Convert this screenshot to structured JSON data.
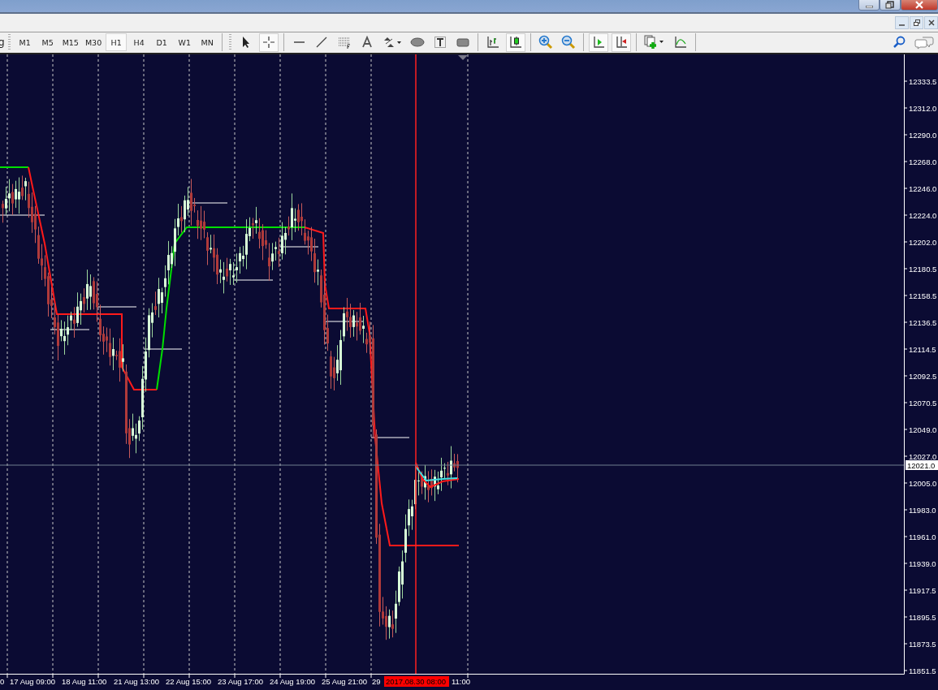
{
  "toolbar": {
    "cut_label": "g",
    "timeframes": [
      {
        "label": "M1",
        "selected": false
      },
      {
        "label": "M5",
        "selected": false
      },
      {
        "label": "M15",
        "selected": false
      },
      {
        "label": "M30",
        "selected": false
      },
      {
        "label": "H1",
        "selected": true
      },
      {
        "label": "H4",
        "selected": false
      },
      {
        "label": "D1",
        "selected": false
      },
      {
        "label": "W1",
        "selected": false
      },
      {
        "label": "MN",
        "selected": false
      }
    ],
    "tool_groups": [
      [
        {
          "kind": "cursor",
          "pressed": false
        },
        {
          "kind": "crosshair",
          "pressed": true
        }
      ],
      [
        {
          "kind": "hline",
          "pressed": false
        },
        {
          "kind": "trendline",
          "pressed": false
        },
        {
          "kind": "fibo",
          "pressed": false
        },
        {
          "kind": "text",
          "pressed": false
        },
        {
          "kind": "arrows",
          "pressed": false
        },
        {
          "kind": "ellipse",
          "pressed": false
        },
        {
          "kind": "label",
          "pressed": false
        },
        {
          "kind": "rect",
          "pressed": false
        }
      ],
      [
        {
          "kind": "bars",
          "pressed": false
        },
        {
          "kind": "candles",
          "pressed": true
        }
      ],
      [
        {
          "kind": "zoomin",
          "pressed": false
        },
        {
          "kind": "zoomout",
          "pressed": false
        }
      ],
      [
        {
          "kind": "autoscroll",
          "pressed": true
        },
        {
          "kind": "shift",
          "pressed": true
        }
      ],
      [
        {
          "kind": "indicator",
          "pressed": false
        },
        {
          "kind": "template",
          "pressed": false
        }
      ]
    ]
  },
  "chart": {
    "price_labels": [
      "12333.5",
      "12312.0",
      "12290.0",
      "12268.0",
      "12246.0",
      "12224.0",
      "12202.0",
      "12180.5",
      "12158.5",
      "12136.5",
      "12114.5",
      "12092.5",
      "12070.5",
      "12049.0",
      "12027.0",
      "12005.0",
      "11983.0",
      "11961.0",
      "11939.0",
      "11917.5",
      "11895.5",
      "11873.5",
      "11851.5"
    ],
    "current_price": "12021.0",
    "time_labels": [
      {
        "text": "0",
        "highlighted": false
      },
      {
        "text": "17 Aug 09:00",
        "highlighted": false
      },
      {
        "text": "18 Aug 11:00",
        "highlighted": false
      },
      {
        "text": "21 Aug 13:00",
        "highlighted": false
      },
      {
        "text": "22 Aug 15:00",
        "highlighted": false
      },
      {
        "text": "23 Aug 17:00",
        "highlighted": false
      },
      {
        "text": "24 Aug 19:00",
        "highlighted": false
      },
      {
        "text": "25 Aug 21:00",
        "highlighted": false
      },
      {
        "text": "29",
        "highlighted": false
      },
      {
        "text": "2017.08.30 08:00",
        "highlighted": true
      },
      {
        "text": "11:00",
        "highlighted": false
      }
    ]
  }
}
